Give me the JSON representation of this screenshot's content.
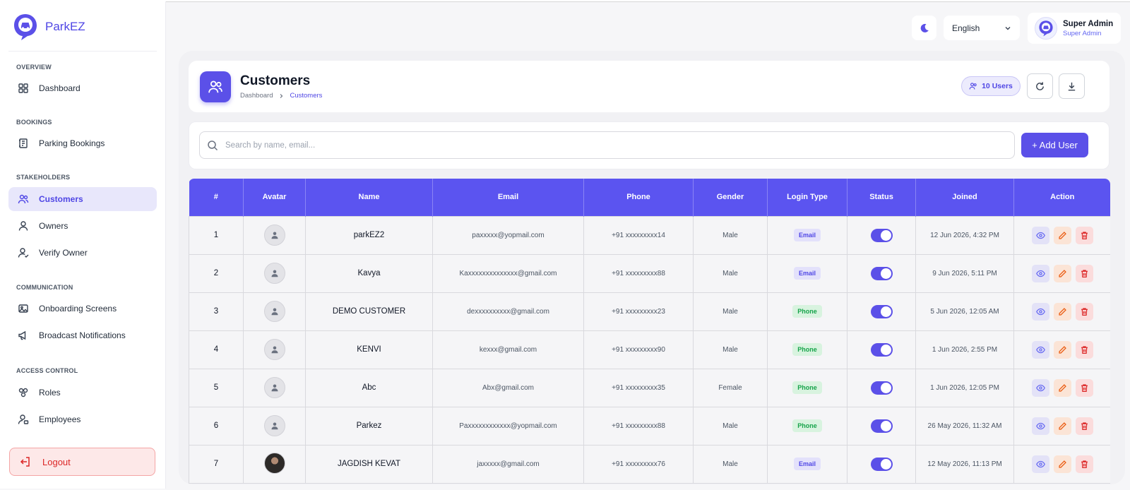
{
  "app": {
    "name": "ParkEZ"
  },
  "sidebar": {
    "sections": [
      {
        "label": "OVERVIEW"
      },
      {
        "label": "BOOKINGS"
      },
      {
        "label": "STAKEHOLDERS"
      },
      {
        "label": "COMMUNICATION"
      },
      {
        "label": "ACCESS CONTROL"
      }
    ],
    "items": [
      {
        "label": "Dashboard",
        "icon": "grid-icon"
      },
      {
        "label": "Parking Bookings",
        "icon": "booking-icon"
      },
      {
        "label": "Customers",
        "icon": "users-icon",
        "active": true
      },
      {
        "label": "Owners",
        "icon": "user-icon"
      },
      {
        "label": "Verify Owner",
        "icon": "user-check-icon"
      },
      {
        "label": "Onboarding Screens",
        "icon": "image-icon"
      },
      {
        "label": "Broadcast Notifications",
        "icon": "megaphone-icon"
      },
      {
        "label": "Roles",
        "icon": "roles-icon"
      },
      {
        "label": "Employees",
        "icon": "employee-icon"
      }
    ],
    "logout_label": "Logout"
  },
  "topbar": {
    "language": "English",
    "user_name": "Super Admin",
    "user_role": "Super Admin"
  },
  "page": {
    "title": "Customers",
    "breadcrumb": [
      "Dashboard",
      "Customers"
    ],
    "users_count": "10 Users",
    "search_placeholder": "Search by name, email...",
    "add_button": "+ Add User"
  },
  "table": {
    "columns": [
      "#",
      "Avatar",
      "Name",
      "Email",
      "Phone",
      "Gender",
      "Login Type",
      "Status",
      "Joined",
      "Action"
    ],
    "rows": [
      {
        "num": "1",
        "name": "parkEZ2",
        "email": "paxxxxx@yopmail.com",
        "phone": "+91 xxxxxxxxx14",
        "gender": "Male",
        "login": "Email",
        "status": true,
        "joined": "12 Jun 2026, 4:32 PM",
        "avatar": "placeholder"
      },
      {
        "num": "2",
        "name": "Kavya",
        "email": "Kaxxxxxxxxxxxxxx@gmail.com",
        "phone": "+91 xxxxxxxxx88",
        "gender": "Male",
        "login": "Email",
        "status": true,
        "joined": "9 Jun 2026, 5:11 PM",
        "avatar": "placeholder"
      },
      {
        "num": "3",
        "name": "DEMO CUSTOMER",
        "email": "dexxxxxxxxxx@gmail.com",
        "phone": "+91 xxxxxxxxx23",
        "gender": "Male",
        "login": "Phone",
        "status": true,
        "joined": "5 Jun 2026, 12:05 AM",
        "avatar": "placeholder"
      },
      {
        "num": "4",
        "name": "KENVI",
        "email": "kexxx@gmail.com",
        "phone": "+91 xxxxxxxxx90",
        "gender": "Male",
        "login": "Phone",
        "status": true,
        "joined": "1 Jun 2026, 2:55 PM",
        "avatar": "placeholder"
      },
      {
        "num": "5",
        "name": "Abc",
        "email": "Abx@gmail.com",
        "phone": "+91 xxxxxxxxx35",
        "gender": "Female",
        "login": "Phone",
        "status": true,
        "joined": "1 Jun 2026, 12:05 PM",
        "avatar": "placeholder"
      },
      {
        "num": "6",
        "name": "Parkez",
        "email": "Paxxxxxxxxxxxx@yopmail.com",
        "phone": "+91 xxxxxxxxx88",
        "gender": "Male",
        "login": "Phone",
        "status": true,
        "joined": "26 May 2026, 11:32 AM",
        "avatar": "placeholder"
      },
      {
        "num": "7",
        "name": "JAGDISH KEVAT",
        "email": "jaxxxxx@gmail.com",
        "phone": "+91 xxxxxxxxx76",
        "gender": "Male",
        "login": "Email",
        "status": true,
        "joined": "12 May 2026, 11:13 PM",
        "avatar": "photo"
      }
    ]
  },
  "colors": {
    "accent": "#5b50e8",
    "danger": "#dc2626",
    "success": "#16a34a"
  }
}
